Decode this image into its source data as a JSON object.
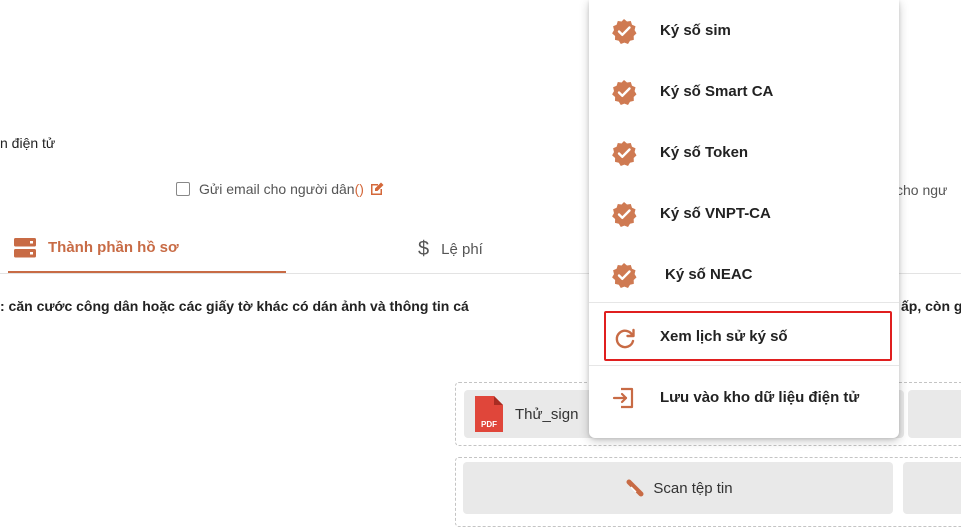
{
  "page": {
    "section_label": "n điện tử",
    "email_checkbox_label": "Gửi email cho người dân",
    "email_paren": "()",
    "right_clip_text": "cho ngư",
    "tabs": [
      {
        "label": "Thành phần hồ sơ",
        "active": true,
        "icon": "server-icon"
      },
      {
        "label": "Lệ phí",
        "active": false,
        "icon": "dollar-icon"
      }
    ],
    "description": ": căn cước công dân hoặc các giấy tờ khác có dán ảnh và thông tin cá",
    "description_right": "ấp, còn g",
    "file_name": "Thử_sign",
    "scan_button_label": "Scan tệp tin"
  },
  "menu": {
    "items": [
      {
        "label": "Ký số sim",
        "icon": "verified-badge-icon"
      },
      {
        "label": "Ký số Smart CA",
        "icon": "verified-badge-icon"
      },
      {
        "label": "Ký số Token",
        "icon": "verified-badge-icon"
      },
      {
        "label": "Ký số VNPT-CA",
        "icon": "verified-badge-icon"
      },
      {
        "label": "Ký số NEAC",
        "icon": "verified-badge-icon"
      },
      {
        "label": "Xem lịch sử ký số",
        "icon": "refresh-icon",
        "highlighted": true
      },
      {
        "label": "Lưu vào kho dữ liệu điện tử",
        "icon": "sign-in-icon"
      }
    ]
  },
  "colors": {
    "accent": "#c86b45",
    "badge": "#cf7a52",
    "highlight_border": "#e01f1f",
    "pdf_red": "#e0463a"
  }
}
